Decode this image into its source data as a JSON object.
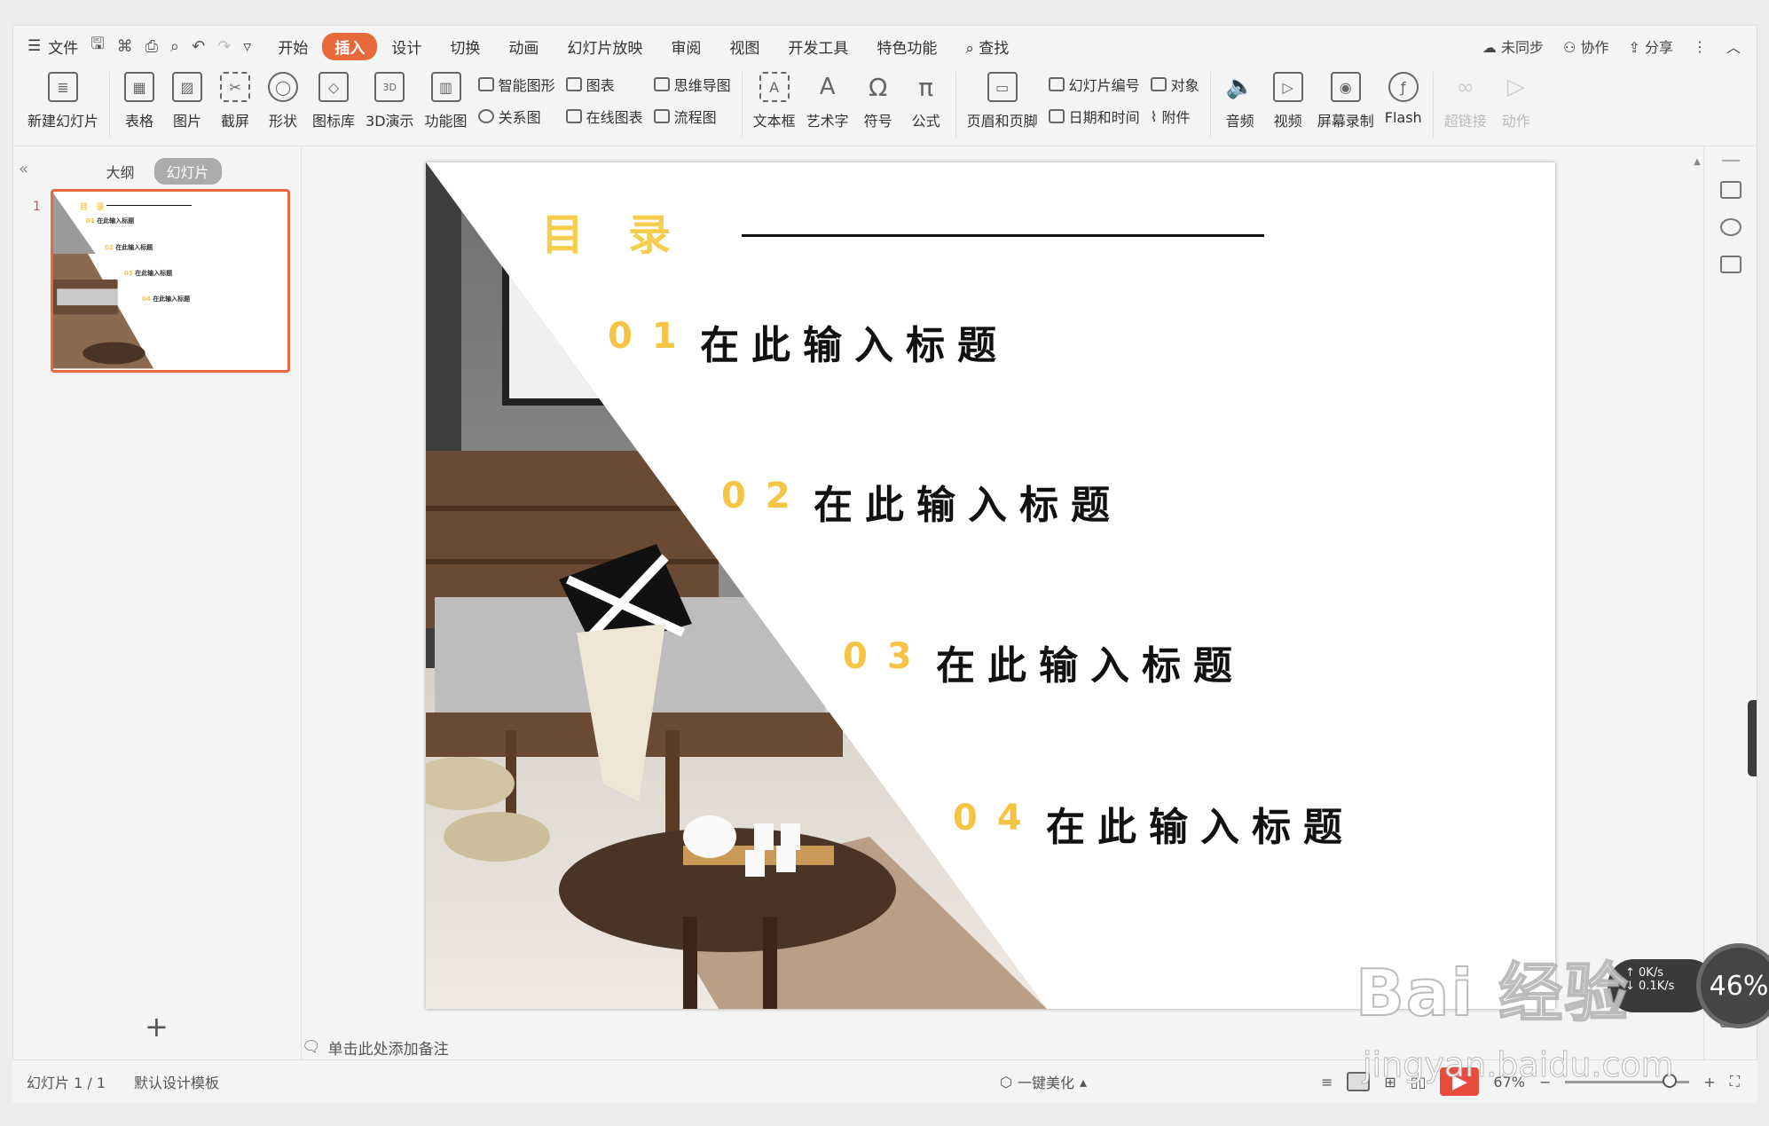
{
  "menubar": {
    "file": "文件",
    "tabs": [
      "开始",
      "插入",
      "设计",
      "切换",
      "动画",
      "幻灯片放映",
      "审阅",
      "视图",
      "开发工具",
      "特色功能"
    ],
    "active_tab": "插入",
    "search": "查找",
    "sync": "未同步",
    "collab": "协作",
    "share": "分享"
  },
  "ribbon": {
    "new_slide": "新建幻灯片",
    "table": "表格",
    "picture": "图片",
    "screenshot": "截屏",
    "shape": "形状",
    "icon_lib": "图标库",
    "demo3d": "3D演示",
    "func_chart": "功能图",
    "smart_shape": "智能图形",
    "chart": "图表",
    "relation": "关系图",
    "online_chart": "在线图表",
    "mindmap": "思维导图",
    "flowchart": "流程图",
    "textbox": "文本框",
    "wordart": "艺术字",
    "symbol": "符号",
    "formula": "公式",
    "header_footer": "页眉和页脚",
    "slide_number": "幻灯片编号",
    "object": "对象",
    "datetime": "日期和时间",
    "attachment": "附件",
    "audio": "音频",
    "video": "视频",
    "screen_rec": "屏幕录制",
    "flash": "Flash",
    "hyperlink": "超链接",
    "action": "动作"
  },
  "leftpanel": {
    "outline_tab": "大纲",
    "slides_tab": "幻灯片",
    "slide_index": "1"
  },
  "slide": {
    "title_a": "目",
    "title_b": "录",
    "items": [
      {
        "num": "01",
        "text": "在此输入标题"
      },
      {
        "num": "02",
        "text": "在此输入标题"
      },
      {
        "num": "03",
        "text": "在此输入标题"
      },
      {
        "num": "04",
        "text": "在此输入标题"
      }
    ]
  },
  "notes": {
    "placeholder": "单击此处添加备注"
  },
  "status": {
    "slide_pos": "幻灯片 1 / 1",
    "template": "默认设计模板",
    "beautify": "一键美化",
    "zoom": "67%"
  },
  "widget": {
    "up": "0K/s",
    "down": "0.1K/s",
    "percent": "46%"
  },
  "watermark": {
    "line1": "Bai 经验",
    "line2": "jingyan.baidu.com"
  },
  "colors": {
    "accent": "#e86a3a",
    "title_yellow": "#f6cd4c",
    "num_yellow": "#f6c445"
  }
}
